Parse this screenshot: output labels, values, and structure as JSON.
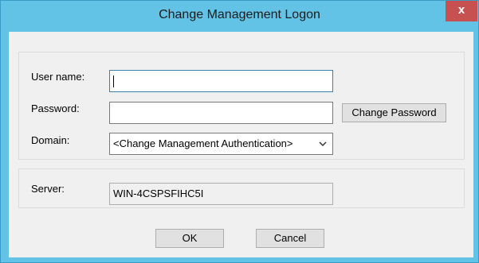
{
  "window": {
    "title": "Change Management Logon",
    "close_glyph": "x"
  },
  "form": {
    "username_label": "User name:",
    "username_value": "",
    "password_label": "Password:",
    "password_value": "",
    "change_password_label": "Change Password",
    "domain_label": "Domain:",
    "domain_value": "<Change Management Authentication>",
    "dropdown_icon": "chevron-down-icon",
    "server_label": "Server:",
    "server_value": "WIN-4CSPSFIHC5I"
  },
  "buttons": {
    "ok_label": "OK",
    "cancel_label": "Cancel"
  },
  "colors": {
    "titlebar": "#62c3e6",
    "close": "#c75050",
    "client": "#f0f0f0"
  }
}
